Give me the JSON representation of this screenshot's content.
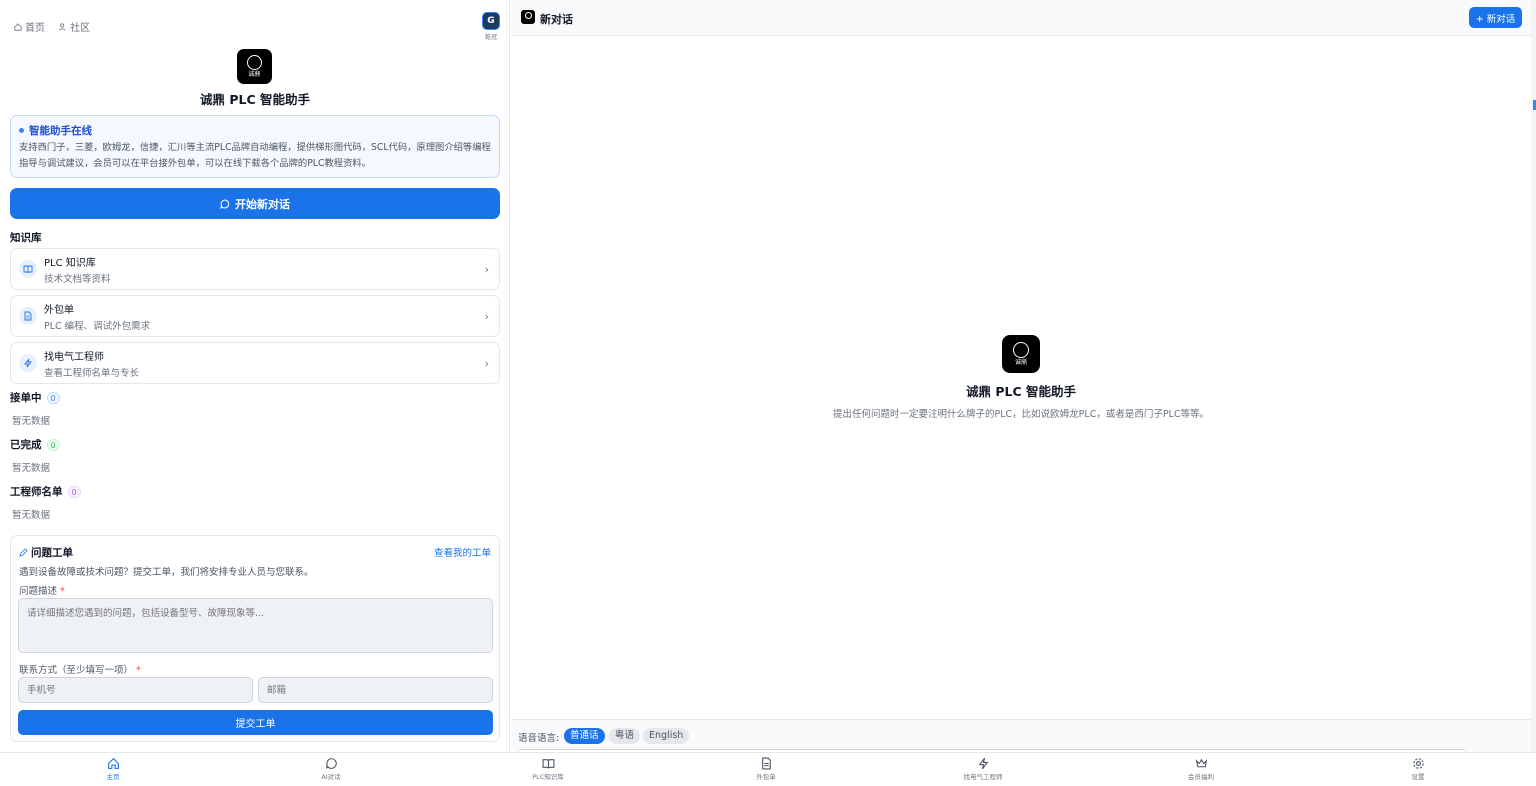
{
  "topnav": {
    "home": "首页",
    "community": "社区"
  },
  "user": {
    "name": "乾冠",
    "initial": "G"
  },
  "app": {
    "title": "诚鼎 PLC 智能助手",
    "logo_text": "诚鼎"
  },
  "info": {
    "heading": "智能助手在线",
    "body": "支持西门子，三菱，欧姆龙，信捷，汇川等主流PLC品牌自动编程，提供梯形图代码，SCL代码，原理图介绍等编程指导与调试建议，会员可以在平台接外包单，可以在线下载各个品牌的PLC教程资料。"
  },
  "start_button": "开始新对话",
  "knowledge": {
    "title": "知识库",
    "items": [
      {
        "title": "PLC 知识库",
        "desc": "技术文档等资料",
        "icon": "book-icon"
      },
      {
        "title": "外包单",
        "desc": "PLC 编程、调试外包需求",
        "icon": "document-icon"
      },
      {
        "title": "找电气工程师",
        "desc": "查看工程师名单与专长",
        "icon": "lightning-icon"
      }
    ]
  },
  "sections": [
    {
      "title": "接单中",
      "count": "0",
      "empty": "暂无数据"
    },
    {
      "title": "已完成",
      "count": "0",
      "empty": "暂无数据"
    },
    {
      "title": "工程师名单",
      "count": "0",
      "empty": "暂无数据"
    }
  ],
  "ticket": {
    "title": "问题工单",
    "link": "查看我的工单",
    "desc": "遇到设备故障或技术问题？提交工单，我们将安排专业人员与您联系。",
    "problem_label": "问题描述",
    "problem_placeholder": "请详细描述您遇到的问题，包括设备型号、故障现象等...",
    "contact_label": "联系方式（至少填写一项）",
    "phone_placeholder": "手机号",
    "email_placeholder": "邮箱",
    "submit": "提交工单",
    "required_mark": "*"
  },
  "chat": {
    "header_title": "新对话",
    "new_button": "+ 新对话",
    "center_title": "诚鼎 PLC 智能助手",
    "center_subtitle": "提出任何问题时一定要注明什么牌子的PLC，比如说欧姆龙PLC，或者是西门子PLC等等。"
  },
  "language": {
    "label": "语音语言:",
    "options": [
      "普通话",
      "粤语",
      "English"
    ],
    "selected": "普通话"
  },
  "bottom_nav": [
    {
      "label": "主页",
      "icon": "home-icon",
      "active": true
    },
    {
      "label": "AI对话",
      "icon": "chat-icon",
      "active": false
    },
    {
      "label": "PLC知识库",
      "icon": "book-icon",
      "active": false
    },
    {
      "label": "外包单",
      "icon": "document-icon",
      "active": false
    },
    {
      "label": "找电气工程师",
      "icon": "lightning-icon",
      "active": false
    },
    {
      "label": "会员福利",
      "icon": "crown-icon",
      "active": false
    },
    {
      "label": "设置",
      "icon": "gear-icon",
      "active": false
    }
  ],
  "colors": {
    "primary": "#1a73e8",
    "info_bg": "#f5f9ff",
    "info_border": "#bfdbfe"
  }
}
